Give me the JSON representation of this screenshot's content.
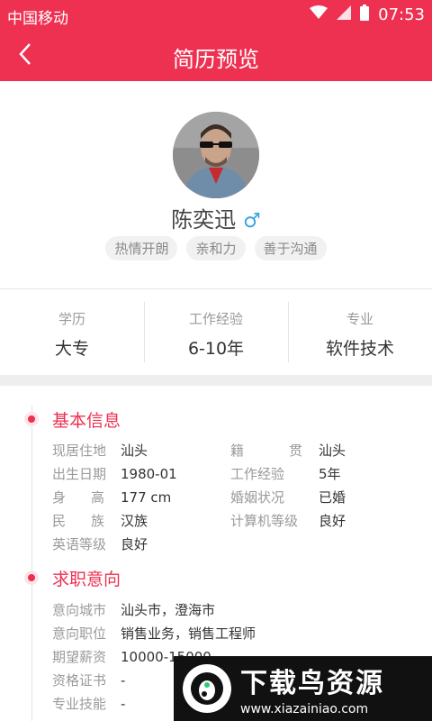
{
  "status_bar": {
    "carrier": "中国移动",
    "time": "07:53"
  },
  "nav": {
    "title": "简历预览"
  },
  "profile": {
    "name": "陈奕迅",
    "gender_symbol": "♂",
    "tags": [
      "热情开朗",
      "亲和力",
      "善于沟通"
    ]
  },
  "stats": [
    {
      "label": "学历",
      "value": "大专"
    },
    {
      "label": "工作经验",
      "value": "6-10年"
    },
    {
      "label": "专业",
      "value": "软件技术"
    }
  ],
  "basic": {
    "title": "基本信息",
    "left": [
      {
        "k": "现居住地",
        "v": "汕头"
      },
      {
        "k": "出生日期",
        "v": "1980-01"
      },
      {
        "k": "身　高",
        "v": "177 cm"
      },
      {
        "k": "民　族",
        "v": "汉族"
      },
      {
        "k": "英语等级",
        "v": "良好"
      }
    ],
    "right": [
      {
        "k": "籍　贯",
        "v": "汕头"
      },
      {
        "k": "工作经验",
        "v": "5年"
      },
      {
        "k": "婚姻状况",
        "v": "已婚"
      },
      {
        "k": "计算机等级",
        "v": "良好"
      }
    ]
  },
  "intent": {
    "title": "求职意向",
    "rows": [
      {
        "k": "意向城市",
        "v": "汕头市，澄海市"
      },
      {
        "k": "意向职位",
        "v": "销售业务，销售工程师"
      },
      {
        "k": "期望薪资",
        "v": "10000-15000"
      },
      {
        "k": "资格证书",
        "v": "-"
      },
      {
        "k": "专业技能",
        "v": "-"
      }
    ]
  },
  "watermark": {
    "big": "下载鸟资源",
    "small": "www.xiazainiao.com"
  },
  "colors": {
    "accent": "#ee3051",
    "gender": "#3aa5e0"
  }
}
